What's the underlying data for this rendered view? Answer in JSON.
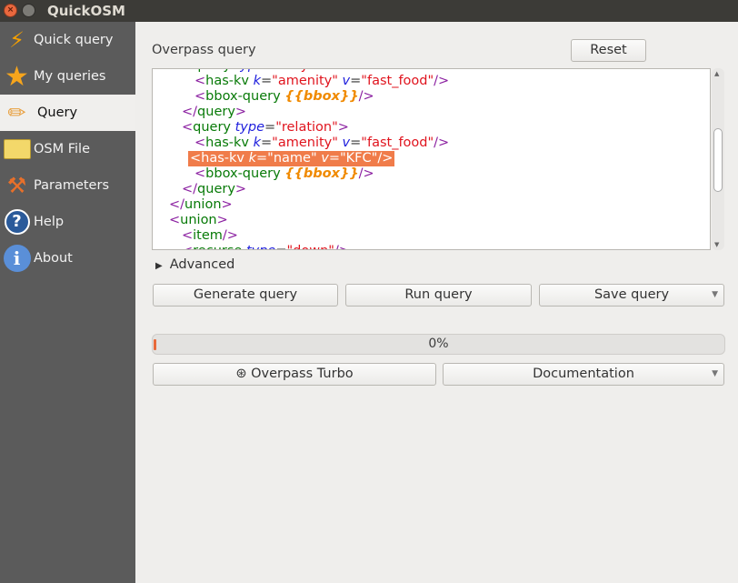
{
  "window": {
    "title": "QuickOSM"
  },
  "sidebar": {
    "items": [
      {
        "label": "Quick query",
        "icon": "lightning-icon",
        "selected": false
      },
      {
        "label": "My queries",
        "icon": "star-icon",
        "selected": false
      },
      {
        "label": "Query",
        "icon": "pencil-icon",
        "selected": true
      },
      {
        "label": "OSM File",
        "icon": "folder-icon",
        "selected": false
      },
      {
        "label": "Parameters",
        "icon": "tools-icon",
        "selected": false
      },
      {
        "label": "Help",
        "icon": "help-icon",
        "selected": false
      },
      {
        "label": "About",
        "icon": "info-icon",
        "selected": false
      }
    ]
  },
  "main": {
    "overpass_label": "Overpass query",
    "reset_label": "Reset",
    "code_lines": [
      {
        "indent": 2,
        "tokens": [
          [
            "p",
            "<"
          ],
          [
            "g",
            "query "
          ],
          [
            "a",
            "type"
          ],
          [
            "e",
            "="
          ],
          [
            "v",
            "\"way\""
          ],
          [
            "p",
            ">"
          ]
        ]
      },
      {
        "indent": 3,
        "tokens": [
          [
            "p",
            "<"
          ],
          [
            "g",
            "has-kv "
          ],
          [
            "a",
            "k"
          ],
          [
            "e",
            "="
          ],
          [
            "v",
            "\"amenity\" "
          ],
          [
            "a",
            "v"
          ],
          [
            "e",
            "="
          ],
          [
            "v",
            "\"fast_food\""
          ],
          [
            "p",
            "/>"
          ]
        ]
      },
      {
        "indent": 3,
        "tokens": [
          [
            "p",
            "<"
          ],
          [
            "g",
            "bbox-query "
          ],
          [
            "b",
            "{{bbox}}"
          ],
          [
            "p",
            "/>"
          ]
        ]
      },
      {
        "indent": 2,
        "tokens": [
          [
            "p",
            "</"
          ],
          [
            "g",
            "query"
          ],
          [
            "p",
            ">"
          ]
        ]
      },
      {
        "indent": 2,
        "tokens": [
          [
            "p",
            "<"
          ],
          [
            "g",
            "query "
          ],
          [
            "a",
            "type"
          ],
          [
            "e",
            "="
          ],
          [
            "v",
            "\"relation\""
          ],
          [
            "p",
            ">"
          ]
        ]
      },
      {
        "indent": 3,
        "tokens": [
          [
            "p",
            "<"
          ],
          [
            "g",
            "has-kv "
          ],
          [
            "a",
            "k"
          ],
          [
            "e",
            "="
          ],
          [
            "v",
            "\"amenity\" "
          ],
          [
            "a",
            "v"
          ],
          [
            "e",
            "="
          ],
          [
            "v",
            "\"fast_food\""
          ],
          [
            "p",
            "/>"
          ]
        ]
      },
      {
        "indent": 3,
        "highlight": true,
        "tokens": [
          [
            "p",
            "<"
          ],
          [
            "g",
            "has-kv "
          ],
          [
            "a",
            "k"
          ],
          [
            "e",
            "="
          ],
          [
            "v",
            "\"name\" "
          ],
          [
            "a",
            "v"
          ],
          [
            "e",
            "="
          ],
          [
            "v",
            "\"KFC\""
          ],
          [
            "p",
            "/>"
          ]
        ]
      },
      {
        "indent": 3,
        "tokens": [
          [
            "p",
            "<"
          ],
          [
            "g",
            "bbox-query "
          ],
          [
            "b",
            "{{bbox}}"
          ],
          [
            "p",
            "/>"
          ]
        ]
      },
      {
        "indent": 2,
        "tokens": [
          [
            "p",
            "</"
          ],
          [
            "g",
            "query"
          ],
          [
            "p",
            ">"
          ]
        ]
      },
      {
        "indent": 1,
        "tokens": [
          [
            "p",
            "</"
          ],
          [
            "g",
            "union"
          ],
          [
            "p",
            ">"
          ]
        ]
      },
      {
        "indent": 1,
        "tokens": [
          [
            "p",
            "<"
          ],
          [
            "g",
            "union"
          ],
          [
            "p",
            ">"
          ]
        ]
      },
      {
        "indent": 2,
        "tokens": [
          [
            "p",
            "<"
          ],
          [
            "g",
            "item"
          ],
          [
            "p",
            "/>"
          ]
        ]
      },
      {
        "indent": 2,
        "tokens": [
          [
            "p",
            "<"
          ],
          [
            "g",
            "recurse "
          ],
          [
            "a",
            "type"
          ],
          [
            "e",
            "="
          ],
          [
            "v",
            "\"down\""
          ],
          [
            "p",
            "/>"
          ]
        ]
      }
    ],
    "advanced_label": "Advanced",
    "generate_label": "Generate query",
    "run_label": "Run query",
    "save_label": "Save query",
    "progress": {
      "value": 0,
      "text": "0%"
    },
    "turbo_label": "Overpass Turbo",
    "doc_label": "Documentation"
  },
  "colors": {
    "highlight": "#f07c4a",
    "sidebar": "#5b5b5b",
    "progress": "#e8693a"
  }
}
